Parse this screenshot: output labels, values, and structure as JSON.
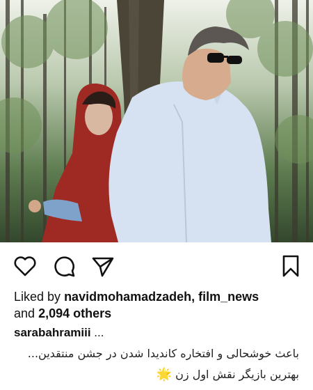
{
  "post": {
    "photo": {
      "subject": "photo of a woman in a red headscarf and a man in sunglasses standing in a forest"
    },
    "actions": {
      "like_icon": "heart-outline-icon",
      "comment_icon": "comment-bubble-icon",
      "share_icon": "paper-plane-icon",
      "save_icon": "bookmark-icon"
    },
    "likes": {
      "prefix": "Liked by",
      "user1": "navidmohamadzadeh",
      "separator": ",",
      "user2": "film_news",
      "and": "and",
      "count": "2,094 others"
    },
    "caption": {
      "username": "sarabahramiii",
      "ellipsis": " ...",
      "line1": "باعث خوشحالی و افتخاره کاندیدا شدن در جشن منتقدین...",
      "line2": "بهترین بازیگر نقش اول زن",
      "star": "🌟"
    }
  },
  "colors": {
    "text": "#111111",
    "background": "#ffffff",
    "star": "#f2b600"
  }
}
